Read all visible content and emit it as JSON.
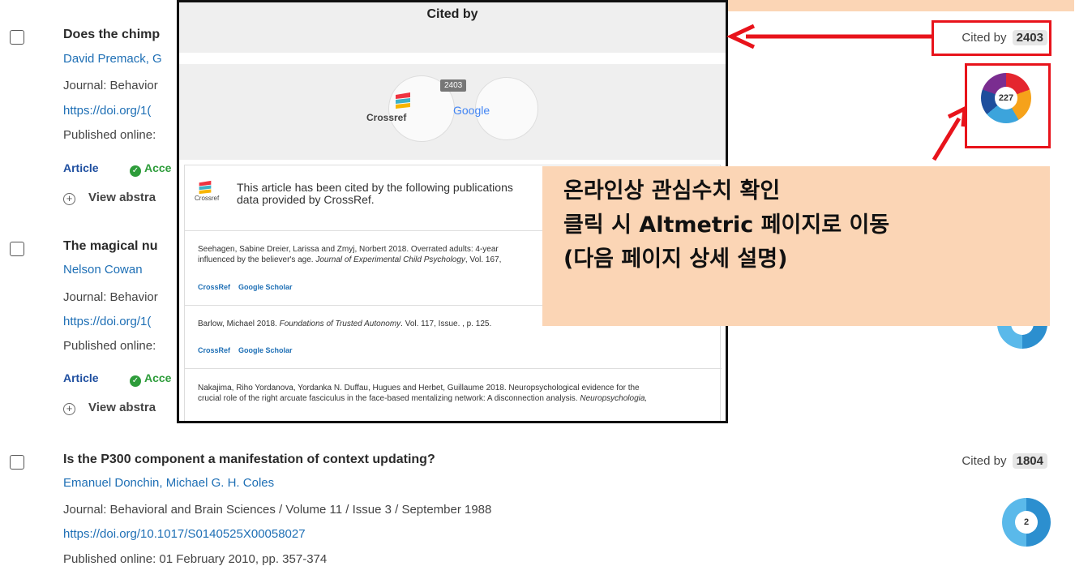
{
  "results": [
    {
      "title": "Does the chimp",
      "authors": "David Premack, G",
      "journal": "Journal: Behavior",
      "doi": "https://doi.org/1(",
      "published": "Published online:",
      "article_label": "Article",
      "access_label": "Acce",
      "view_abstract": "View abstra",
      "cited_label": "Cited by",
      "cited_count": "2403",
      "altmetric_score": "227"
    },
    {
      "title": "The magical nu",
      "authors": "Nelson Cowan",
      "journal": "Journal: Behavior",
      "doi": "https://doi.org/1(",
      "published": "Published online:",
      "article_label": "Article",
      "access_label": "Acce",
      "view_abstract": "View abstra"
    },
    {
      "title": "Is the P300 component a manifestation of context updating?",
      "authors": "Emanuel Donchin, Michael G. H. Coles",
      "journal": "Journal: Behavioral and Brain Sciences / Volume 11 / Issue 3 / September 1988",
      "doi": "https://doi.org/10.1017/S0140525X00058027",
      "published": "Published online: 01 February 2010, pp. 357-374",
      "cited_label": "Cited by",
      "cited_count": "1804",
      "altmetric_score": "2"
    }
  ],
  "popup": {
    "title": "Cited by",
    "count_badge": "2403",
    "crossref_label": "Crossref",
    "google_label": "Google",
    "intro_line1": "This article has been cited by the following publications",
    "intro_line2": "data provided by CrossRef.",
    "logo_small_label": "Crossref",
    "citations": [
      {
        "line1": "Seehagen, Sabine Dreier, Larissa and Zmyj, Norbert 2018. Overrated adults: 4-year",
        "line2_plain": "influenced by the believer's age. ",
        "line2_italic": "Journal of Experimental Child Psychology",
        "line2_rest": ", Vol. 167,"
      },
      {
        "line1_plain": "Barlow, Michael 2018. ",
        "line1_italic": "Foundations of Trusted Autonomy",
        "line1_rest": ". Vol. 117, Issue. , p. 125."
      },
      {
        "line1": "Nakajima, Riho Yordanova, Yordanka N. Duffau, Hugues and Herbet, Guillaume 2018. Neuropsychological evidence for the",
        "line2_plain": "crucial role of the right arcuate fasciculus in the face-based mentalizing network: A disconnection analysis. ",
        "line2_italic": "Neuropsychologia,"
      }
    ],
    "link_crossref": "CrossRef",
    "link_scholar": "Google Scholar"
  },
  "annotation": {
    "line1": "온라인상 관심수치 확인",
    "line2": "클릭 시 Altmetric 페이지로 이동",
    "line3": "(다음 페이지 상세 설명)"
  },
  "colors": {
    "link_blue": "#1e6fb5",
    "annotation_red": "#e8131b",
    "annotation_fill": "#fbd5b5",
    "open_access_green": "#2d9c3a"
  },
  "icons": [
    "checkbox-icon",
    "check-circle-icon",
    "plus-circle-icon",
    "altmetric-donut-icon",
    "crossref-logo-icon",
    "red-arrow-icon"
  ]
}
